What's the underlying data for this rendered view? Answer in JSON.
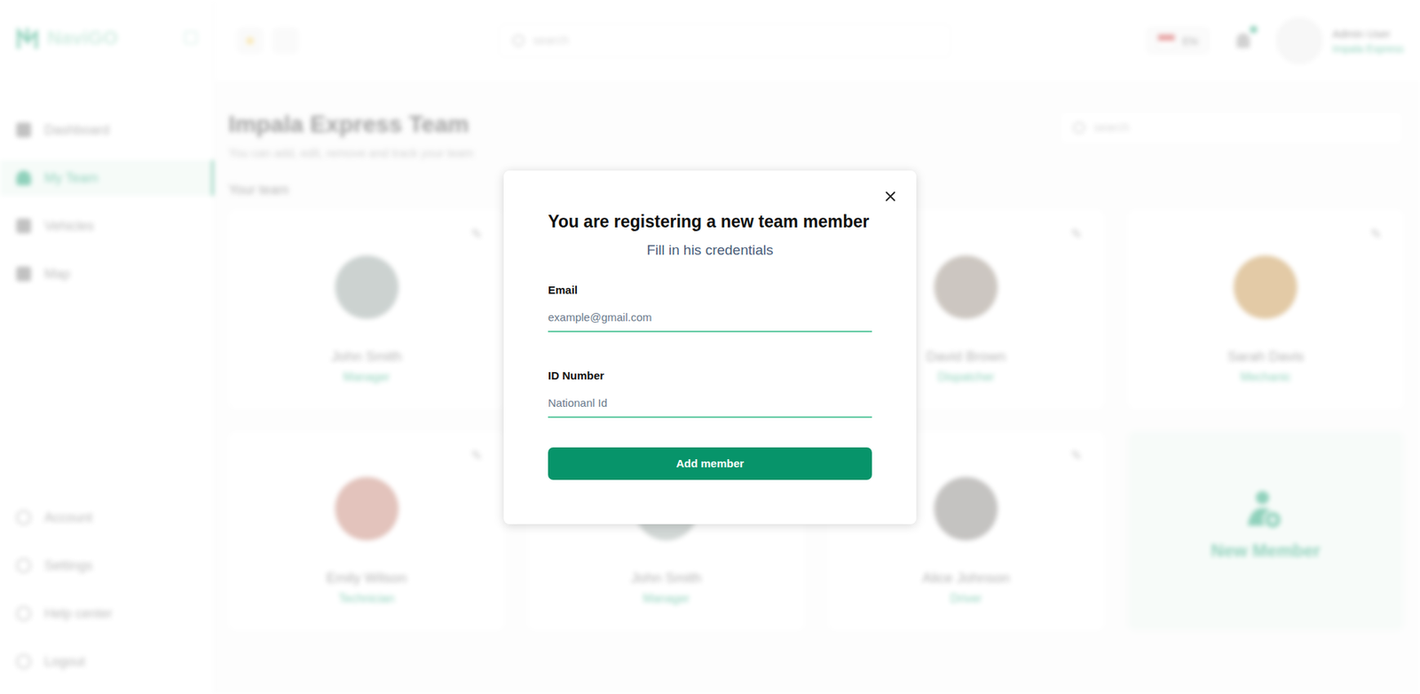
{
  "app": {
    "logo": "NaviGO"
  },
  "sidebar": {
    "items": [
      {
        "label": "Dashboard",
        "selected": false
      },
      {
        "label": "My Team",
        "selected": true
      },
      {
        "label": "Vehicles",
        "selected": false
      },
      {
        "label": "Map",
        "selected": false
      }
    ],
    "bottom_items": [
      {
        "label": "Account"
      },
      {
        "label": "Settings"
      },
      {
        "label": "Help center"
      },
      {
        "label": "Logout"
      }
    ]
  },
  "topbar": {
    "search_placeholder": "search",
    "language": "EN",
    "notification_dot": true,
    "user": {
      "name": "Admin User",
      "company": "Impala Express"
    }
  },
  "page": {
    "title": "Impala Express Team",
    "subtitle": "You can add, edit, remove and track your team",
    "search_placeholder": "search",
    "section": "Your team"
  },
  "members": [
    {
      "name": "John Smith",
      "role": "Manager",
      "color": "#8e9c98"
    },
    {
      "name": "",
      "role": "",
      "color": "#9aa6a2"
    },
    {
      "name": "David Brown",
      "role": "Dispatcher",
      "color": "#8f8275"
    },
    {
      "name": "Sarah Davis",
      "role": "Mechanic",
      "color": "#c08a3a"
    },
    {
      "name": "Emily Wilson",
      "role": "Technician",
      "color": "#c07a6a"
    },
    {
      "name": "John Smith",
      "role": "Manager",
      "color": "#9aa6a2"
    },
    {
      "name": "Alice Johnson",
      "role": "Driver",
      "color": "#7d7a76"
    }
  ],
  "new_member": {
    "label": "New Member"
  },
  "modal": {
    "title": "You are registering a new team member",
    "subtitle": "Fill in his credentials",
    "fields": [
      {
        "label": "Email",
        "placeholder": "example@gmail.com",
        "value": "",
        "focused": true
      },
      {
        "label": "ID Number",
        "placeholder": "Nationanl Id",
        "value": "",
        "focused": false
      }
    ],
    "button": "Add member"
  }
}
